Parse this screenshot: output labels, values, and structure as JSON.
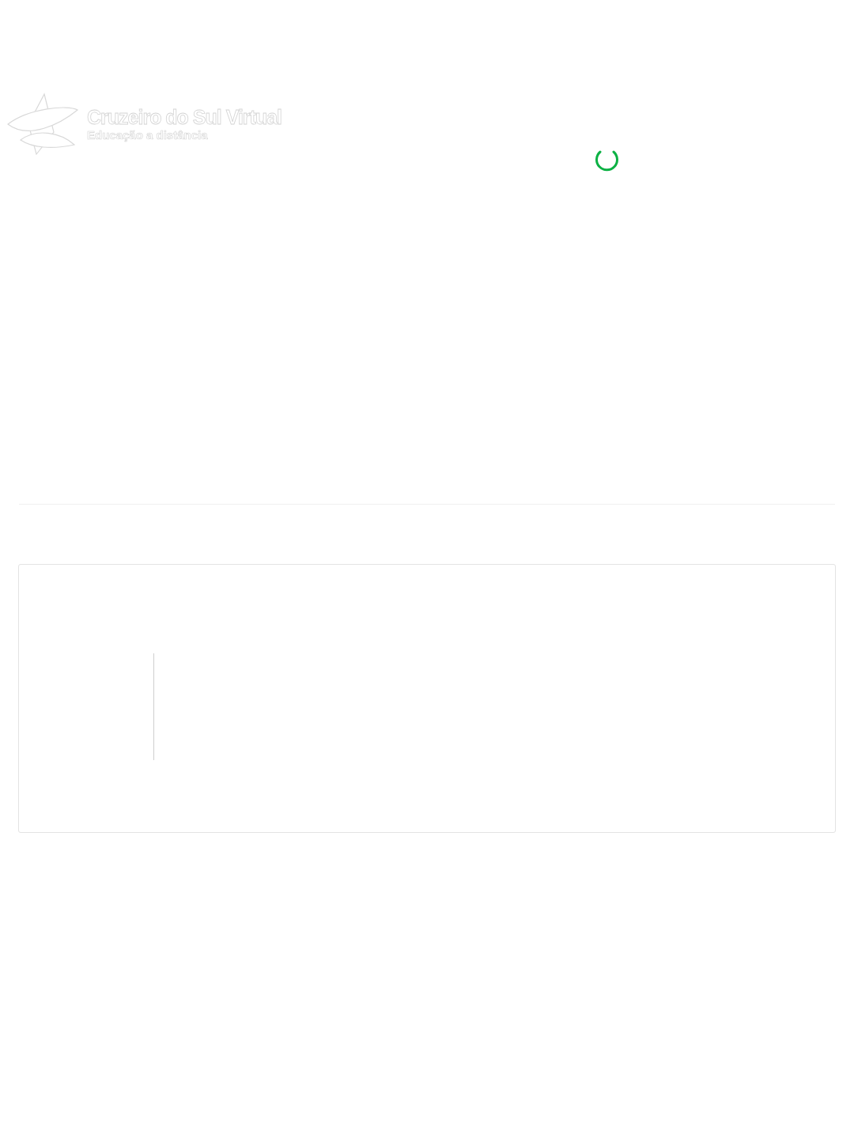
{
  "logo": {
    "name": "Cruzeiro do Sul Virtual",
    "tagline": "Educação a distância"
  },
  "loading": true
}
